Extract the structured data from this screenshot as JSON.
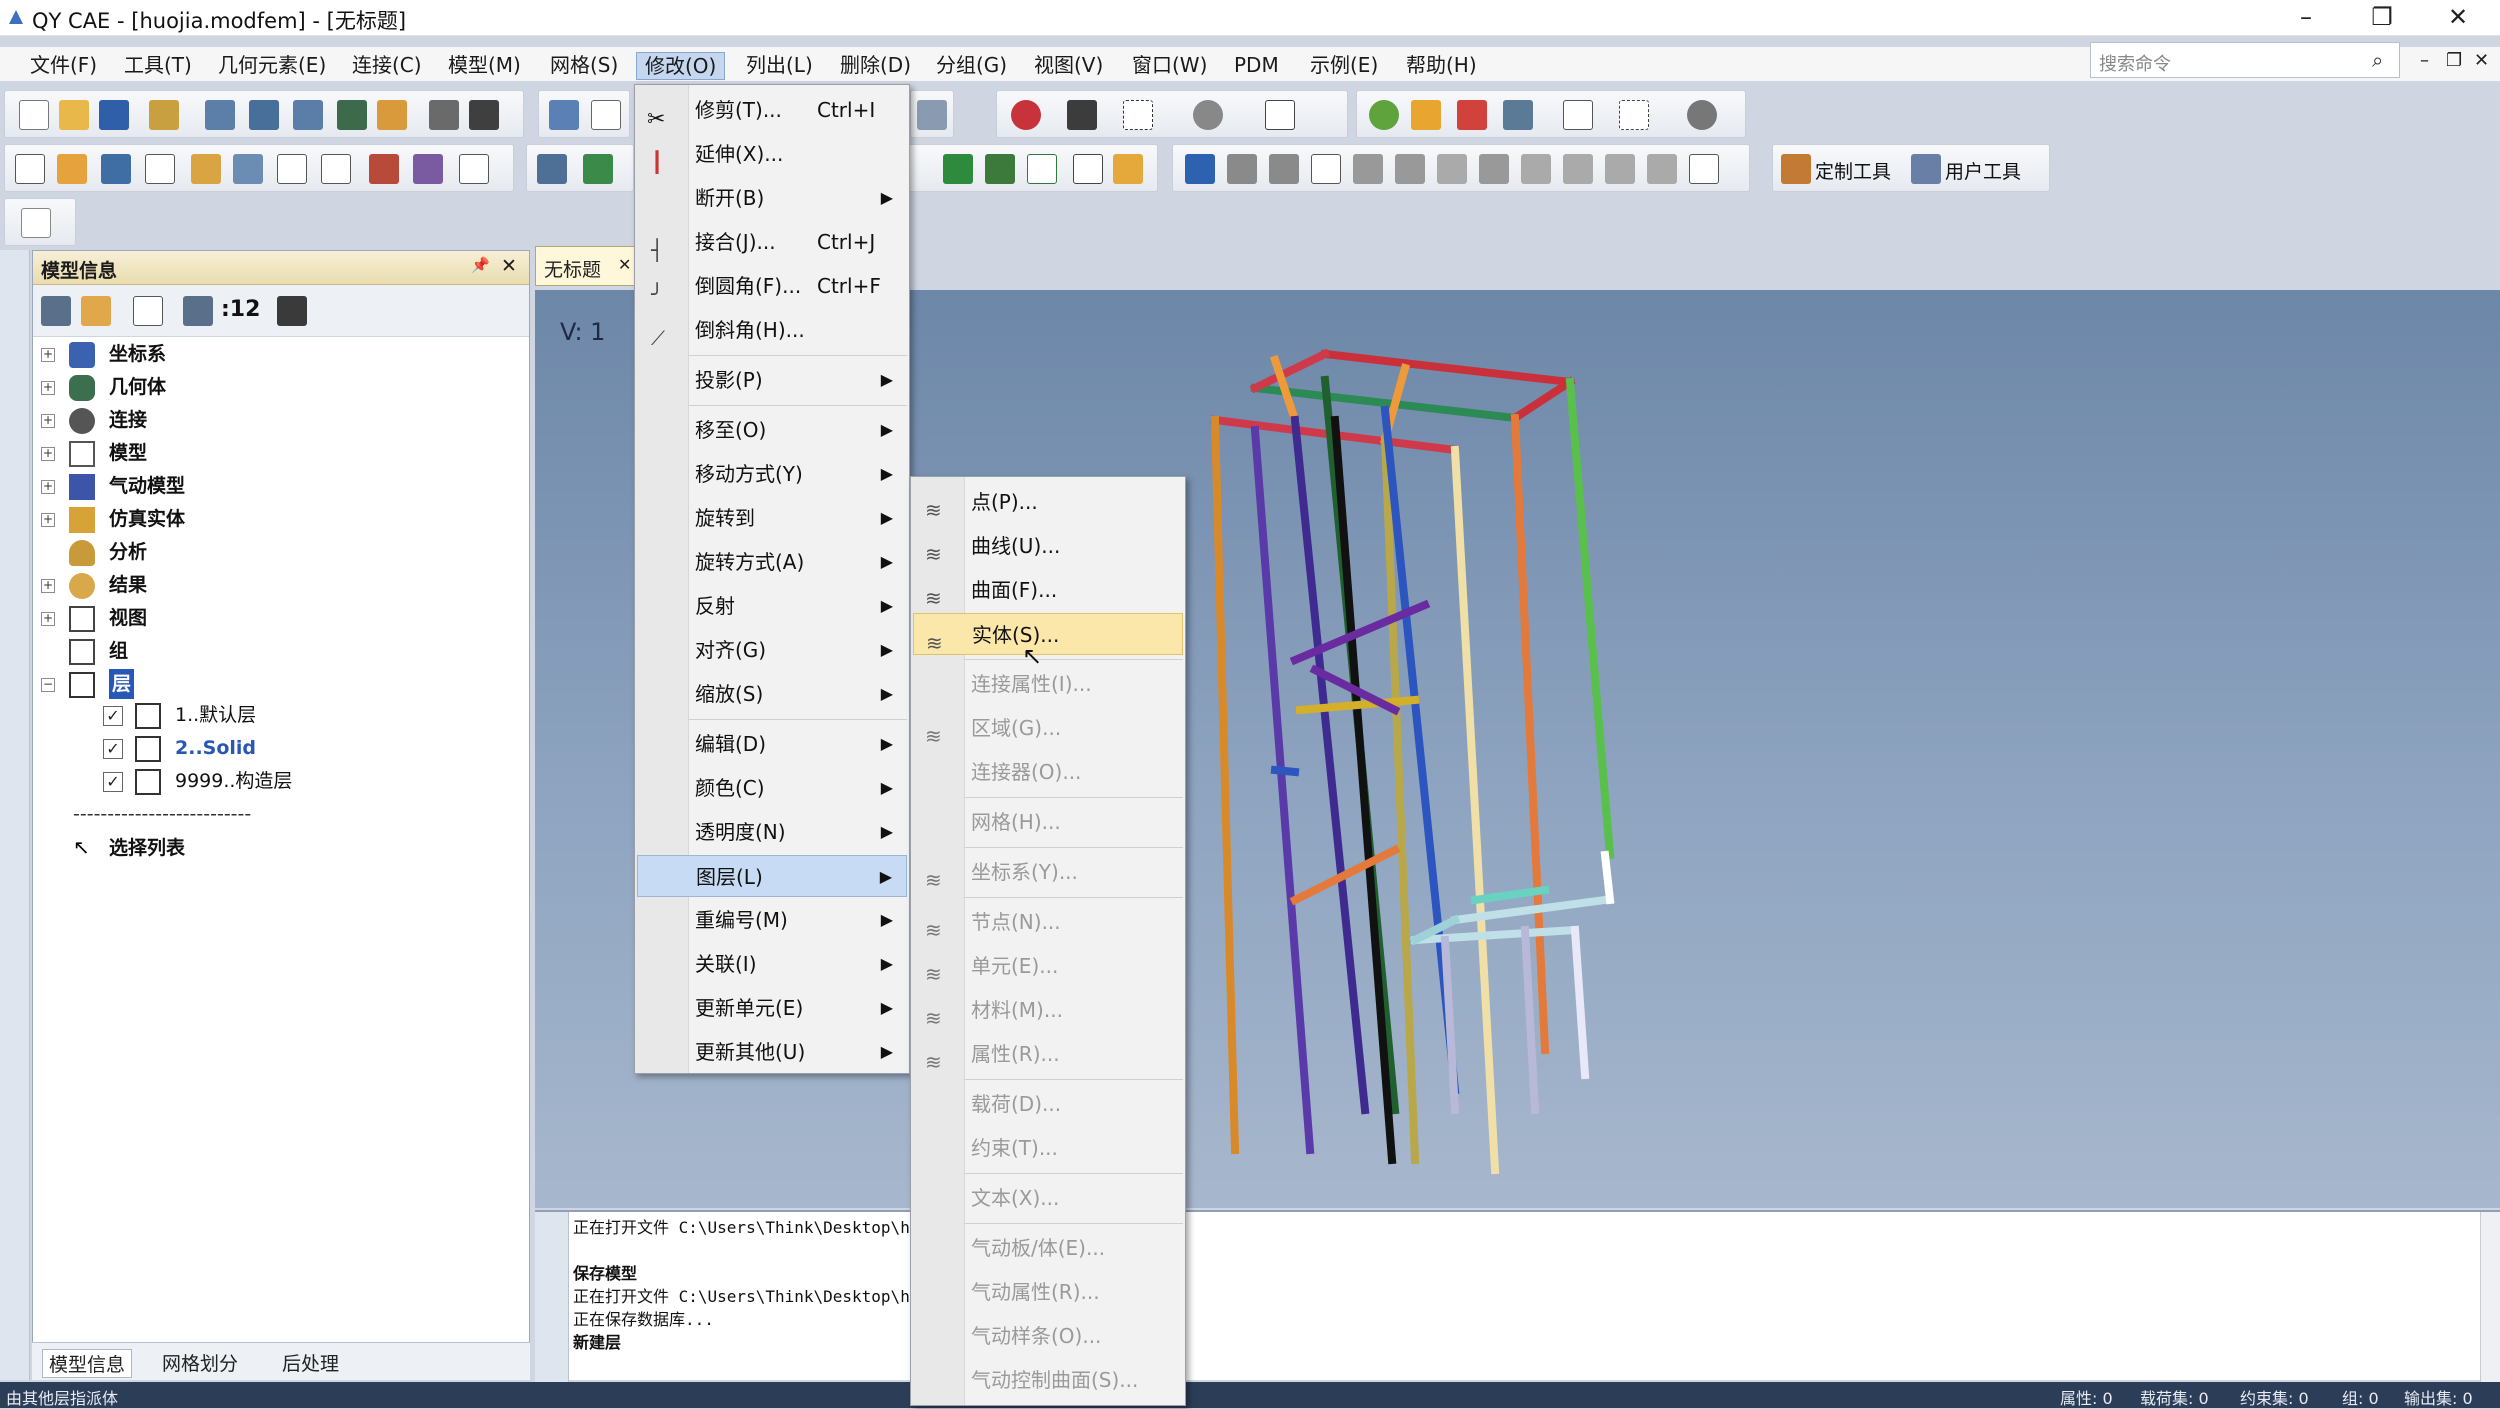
{
  "window": {
    "title": "QY CAE - [huojia.modfem] - [无标题]",
    "minimize": "–",
    "restore": "❐",
    "close": "✕"
  },
  "menubar": {
    "items": [
      "文件(F)",
      "工具(T)",
      "几何元素(E)",
      "连接(C)",
      "模型(M)",
      "网格(S)",
      "修改(O)",
      "列出(L)",
      "删除(D)",
      "分组(G)",
      "视图(V)",
      "窗口(W)",
      "PDM",
      "示例(E)",
      "帮助(H)"
    ],
    "search_placeholder": "搜索命令",
    "mdi_min": "–",
    "mdi_restore": "❐",
    "mdi_close": "✕"
  },
  "toolbar": {
    "custom_tools": "定制工具",
    "user_tools": "用户工具"
  },
  "panel": {
    "title": "模型信息",
    "pin": "📌",
    "close": "✕",
    "count": ":12",
    "tree": [
      {
        "label": "坐标系",
        "exp": "+"
      },
      {
        "label": "几何体",
        "exp": "+"
      },
      {
        "label": "连接",
        "exp": "+"
      },
      {
        "label": "模型",
        "exp": "+"
      },
      {
        "label": "气动模型",
        "exp": "+"
      },
      {
        "label": "仿真实体",
        "exp": "+"
      },
      {
        "label": "分析",
        "exp": ""
      },
      {
        "label": "结果",
        "exp": "+"
      },
      {
        "label": "视图",
        "exp": "+"
      },
      {
        "label": "组",
        "exp": ""
      },
      {
        "label": "层",
        "exp": "−"
      }
    ],
    "layers": [
      {
        "label": "1..默认层",
        "checked": "✓"
      },
      {
        "label": "2..Solid",
        "checked": "✓"
      },
      {
        "label": "9999..构造层",
        "checked": "✓"
      }
    ],
    "separator": "--------------------------",
    "select_list": "选择列表",
    "tabs": [
      "模型信息",
      "网格划分",
      "后处理"
    ]
  },
  "viewport": {
    "doc_tab": "无标题",
    "doc_tab_close": "✕",
    "view_label": "V: 1"
  },
  "modify_menu": [
    {
      "label": "修剪(T)...",
      "shortcut": "Ctrl+I",
      "arrow": ""
    },
    {
      "label": "延伸(X)...",
      "shortcut": "",
      "arrow": ""
    },
    {
      "label": "断开(B)",
      "shortcut": "",
      "arrow": "▶"
    },
    {
      "label": "接合(J)...",
      "shortcut": "Ctrl+J",
      "arrow": ""
    },
    {
      "label": "倒圆角(F)...",
      "shortcut": "Ctrl+F",
      "arrow": ""
    },
    {
      "label": "倒斜角(H)...",
      "shortcut": "",
      "arrow": ""
    },
    {
      "label": "投影(P)",
      "shortcut": "",
      "arrow": "▶"
    },
    {
      "label": "移至(O)",
      "shortcut": "",
      "arrow": "▶"
    },
    {
      "label": "移动方式(Y)",
      "shortcut": "",
      "arrow": "▶"
    },
    {
      "label": "旋转到",
      "shortcut": "",
      "arrow": "▶"
    },
    {
      "label": "旋转方式(A)",
      "shortcut": "",
      "arrow": "▶"
    },
    {
      "label": "反射",
      "shortcut": "",
      "arrow": "▶"
    },
    {
      "label": "对齐(G)",
      "shortcut": "",
      "arrow": "▶"
    },
    {
      "label": "缩放(S)",
      "shortcut": "",
      "arrow": "▶"
    },
    {
      "label": "编辑(D)",
      "shortcut": "",
      "arrow": "▶"
    },
    {
      "label": "颜色(C)",
      "shortcut": "",
      "arrow": "▶"
    },
    {
      "label": "透明度(N)",
      "shortcut": "",
      "arrow": "▶"
    },
    {
      "label": "图层(L)",
      "shortcut": "",
      "arrow": "▶"
    },
    {
      "label": "重编号(M)",
      "shortcut": "",
      "arrow": "▶"
    },
    {
      "label": "关联(I)",
      "shortcut": "",
      "arrow": "▶"
    },
    {
      "label": "更新单元(E)",
      "shortcut": "",
      "arrow": "▶"
    },
    {
      "label": "更新其他(U)",
      "shortcut": "",
      "arrow": "▶"
    }
  ],
  "layer_menu": [
    {
      "label": "点(P)..."
    },
    {
      "label": "曲线(U)..."
    },
    {
      "label": "曲面(F)..."
    },
    {
      "label": "实体(S)..."
    },
    {
      "label": "连接属性(I)..."
    },
    {
      "label": "区域(G)..."
    },
    {
      "label": "连接器(O)..."
    },
    {
      "label": "网格(H)..."
    },
    {
      "label": "坐标系(Y)..."
    },
    {
      "label": "节点(N)..."
    },
    {
      "label": "单元(E)..."
    },
    {
      "label": "材料(M)..."
    },
    {
      "label": "属性(R)..."
    },
    {
      "label": "载荷(D)..."
    },
    {
      "label": "约束(T)..."
    },
    {
      "label": "文本(X)..."
    },
    {
      "label": "气动板/体(E)..."
    },
    {
      "label": "气动属性(R)..."
    },
    {
      "label": "气动样条(O)..."
    },
    {
      "label": "气动控制曲面(S)..."
    }
  ],
  "console": {
    "lines": [
      "正在打开文件 C:\\Users\\Think\\Desktop\\hu",
      "",
      "保存模型",
      "正在打开文件 C:\\Users\\Think\\Desktop\\hu",
      "正在保存数据库...",
      "新建层"
    ]
  },
  "statusbar": {
    "left": "由其他层指派体",
    "items": [
      "属性: 0",
      "载荷集: 0",
      "约束集: 0",
      "组: 0",
      "输出集: 0"
    ]
  }
}
